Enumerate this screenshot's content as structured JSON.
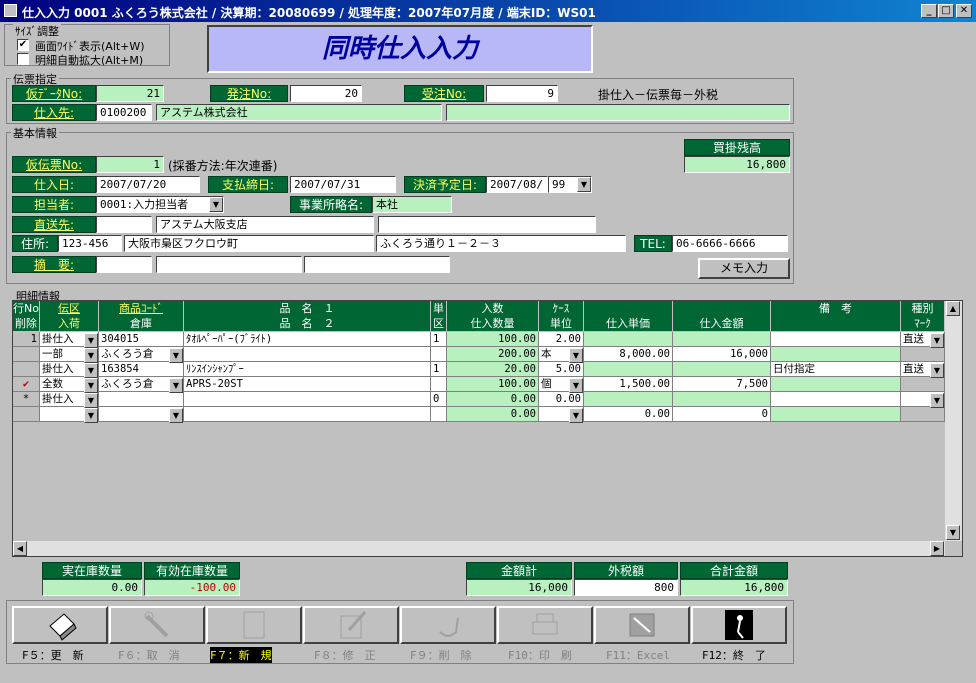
{
  "window": {
    "title": "仕入入力  0001 ふくろう株式会社 / 決算期：20080699 / 処理年度：2007年07月度 / 端末ID：WS01"
  },
  "size_adjust": {
    "legend": "ｻｲｽﾞ調整",
    "screen_wide": "画面ﾜｲﾄﾞ表示(Alt+W)",
    "detail_auto": "明細自動拡大(Alt+M)"
  },
  "screen_title": "同時仕入入力",
  "slip": {
    "legend": "伝票指定",
    "kari_data_label": "仮ﾃﾞｰﾀNo:",
    "kari_data_value": "21",
    "hatchu_label": "発注No:",
    "hatchu_value": "20",
    "juchu_label": "受注No:",
    "juchu_value": "9",
    "note": "掛仕入－伝票毎－外税",
    "supplier_label": "仕入先:",
    "supplier_code": "0100200",
    "supplier_name": "アステム株式会社",
    "supplier_extra": ""
  },
  "basic": {
    "legend": "基本情報",
    "kari_slip_label": "仮伝票No:",
    "kari_slip_value": "1",
    "numbering": "(採番方法:年次連番)",
    "balance_label": "買掛残高",
    "balance_value": "16,800",
    "shiire_date_label": "仕入日:",
    "shiire_date": "2007/07/20",
    "shime_label": "支払締日:",
    "shime_date": "2007/07/31",
    "kessai_label": "決済予定日:",
    "kessai_date": "2007/08/",
    "kessai_day": "99",
    "tanto_label": "担当者:",
    "tanto_value": "0001:入力担当者",
    "office_label": "事業所略名:",
    "office_value": "本社",
    "direct_label": "直送先:",
    "direct_code": "",
    "direct_name": "アステム大阪支店",
    "direct_extra": "",
    "address_label": "住所:",
    "zip": "123-456",
    "addr1": "大阪市梟区フクロウ町",
    "addr2": "ふくろう通り１－２－３",
    "tel_label": "TEL:",
    "tel_value": "06-6666-6666",
    "memo_label": "摘　要:",
    "memo_btn": "メモ入力"
  },
  "detail": {
    "legend": "明細情報",
    "headers": {
      "gyono": "行No",
      "sakujo": "削除",
      "denku": "伝区",
      "nyuka": "入荷",
      "code": "商品ｺｰﾄﾞ",
      "soko": "倉庫",
      "hin1": "品　名　１",
      "hin2": "品　名　２",
      "tan": "単",
      "ku": "区",
      "irisu": "入数",
      "qty": "仕入数量",
      "case": "ｹｰｽ",
      "unit": "単位",
      "price": "仕入単価",
      "amount": "仕入金額",
      "biko": "備　考",
      "shubetsu": "種別",
      "mark": "ﾏｰｸ"
    },
    "rows": [
      {
        "no": "1",
        "denku": "掛仕入",
        "code": "304015",
        "hin1": "ﾀｵﾙﾍﾟｰﾊﾟｰ(ﾌﾞﾗｲﾄ)",
        "ku": "1",
        "irisu": "100.00",
        "case": "2.00",
        "biko": "",
        "shubetsu": "直送",
        "nyuka": "一部",
        "soko": "ふくろう倉",
        "hin2": "",
        "qty": "200.00",
        "unit": "本",
        "price": "8,000.00",
        "amount": "16,000",
        "deleted": false
      },
      {
        "no": "",
        "denku": "掛仕入",
        "code": "163854",
        "hin1": "ﾘﾝｽｲﾝｼｬﾝﾌﾟｰ",
        "ku": "1",
        "irisu": "20.00",
        "case": "5.00",
        "biko": "日付指定",
        "shubetsu": "直送",
        "nyuka": "全数",
        "soko": "ふくろう倉",
        "hin2": "APRS-20ST",
        "qty": "100.00",
        "unit": "個",
        "price": "1,500.00",
        "amount": "7,500",
        "deleted": true
      },
      {
        "no": "*",
        "denku": "掛仕入",
        "code": "",
        "hin1": "",
        "ku": "0",
        "irisu": "0.00",
        "case": "0.00",
        "biko": "",
        "shubetsu": "",
        "nyuka": "",
        "soko": "",
        "hin2": "",
        "qty": "0.00",
        "unit": "",
        "price": "0.00",
        "amount": "0",
        "deleted": false
      }
    ]
  },
  "totals": {
    "jitsu_label": "実在庫数量",
    "jitsu_value": "0.00",
    "yuko_label": "有効在庫数量",
    "yuko_value": "-100.00",
    "kingaku_label": "金額計",
    "kingaku_value": "16,000",
    "tax_label": "外税額",
    "tax_value": "800",
    "total_label": "合計金額",
    "total_value": "16,800"
  },
  "fkeys": [
    {
      "label": "F５：更　新",
      "state": "normal"
    },
    {
      "label": "F６：取　消",
      "state": "disabled"
    },
    {
      "label": "F７：新　規",
      "state": "selected"
    },
    {
      "label": "F８：修　正",
      "state": "disabled"
    },
    {
      "label": "F９：削　除",
      "state": "disabled"
    },
    {
      "label": "F10：印　刷",
      "state": "disabled"
    },
    {
      "label": "F11：Excel",
      "state": "disabled"
    },
    {
      "label": "F12：終　了",
      "state": "normal"
    }
  ],
  "colors": {
    "label_bg": "#006633",
    "label_fg": "#ffff66",
    "field_green": "#b8f0c0",
    "title_bg": "#b8b8f8",
    "title_fg": "#0000a0"
  }
}
